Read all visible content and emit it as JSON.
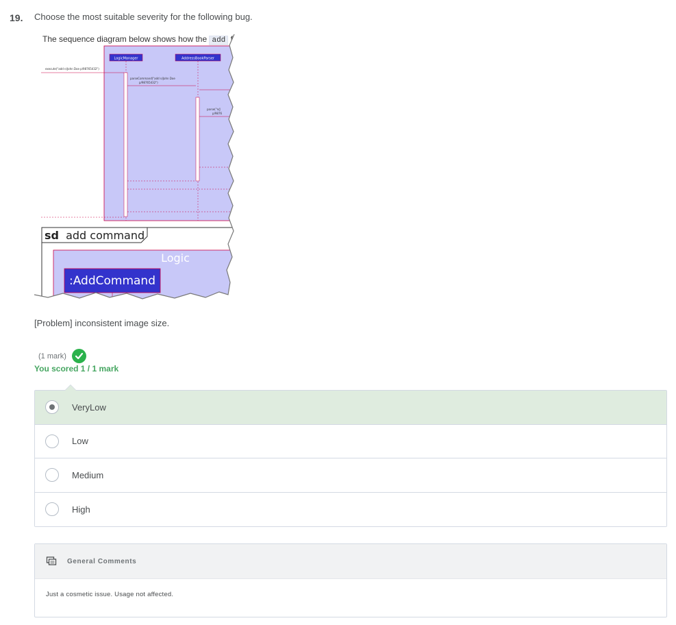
{
  "question": {
    "number": "19.",
    "text": "Choose the most suitable severity for the following bug."
  },
  "bug_image": {
    "intro_text": "The sequence diagram below shows how the",
    "intro_code": "add",
    "intro_tail": "fe",
    "lifeline_1": "LogicManager",
    "lifeline_2": "AddressBookParser",
    "call_execute": "execute(\"add n/John Doe p/98765432\")",
    "call_parse_command_1": "parseCommand(\"add n/John Doe",
    "call_parse_command_2": "p/98765432\")",
    "call_parse_1": "parse(\"n/J",
    "call_parse_2": "p/9876",
    "frame_label_bold": "sd",
    "frame_label": "add command",
    "box_logic": "Logic",
    "box_add_command": ":AddCommand"
  },
  "problem_text": "[Problem] inconsistent image size.",
  "mark": {
    "label": "(1 mark)",
    "score_text": "You scored 1 / 1 mark"
  },
  "options": [
    {
      "label": "VeryLow",
      "selected": true
    },
    {
      "label": "Low",
      "selected": false
    },
    {
      "label": "Medium",
      "selected": false
    },
    {
      "label": "High",
      "selected": false
    }
  ],
  "comments": {
    "title": "General Comments",
    "body": "Just a cosmetic issue. Usage not affected."
  },
  "colors": {
    "correct_green": "#2bb24c",
    "selected_bg": "#dfecdf",
    "diagram_fill": "#c8c8f8",
    "diagram_box": "#3333cc",
    "arrow_red": "#cc0044"
  }
}
